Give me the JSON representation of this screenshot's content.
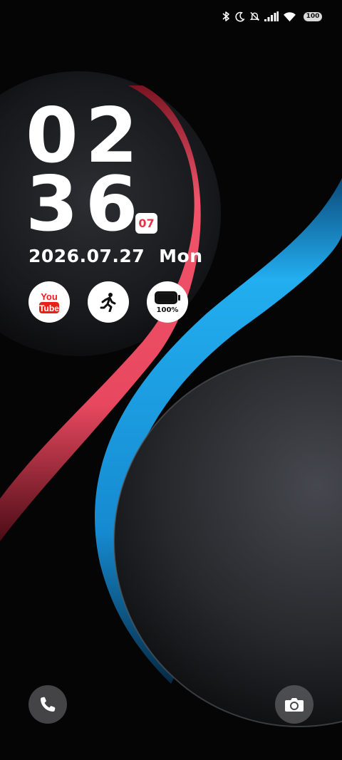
{
  "status_bar": {
    "icons": [
      "bluetooth-icon",
      "moon-icon",
      "bell-off-icon",
      "signal-icon",
      "wifi-icon"
    ],
    "battery": "100"
  },
  "clock": {
    "hour": "02",
    "minute": "36",
    "second_badge": "07"
  },
  "date": {
    "value": "2026.07.27",
    "weekday": "Mon"
  },
  "widgets": {
    "youtube": {
      "icon": "youtube-icon",
      "top": "You",
      "bottom": "Tube"
    },
    "activity": {
      "icon": "running-person-icon"
    },
    "battery": {
      "icon": "battery-icon",
      "percent": "100%"
    }
  },
  "shortcuts": {
    "left": "phone-icon",
    "right": "camera-icon"
  },
  "colors": {
    "accent_red": "#e8344a",
    "accent_blue": "#1aa0e8",
    "background": "#050506"
  }
}
